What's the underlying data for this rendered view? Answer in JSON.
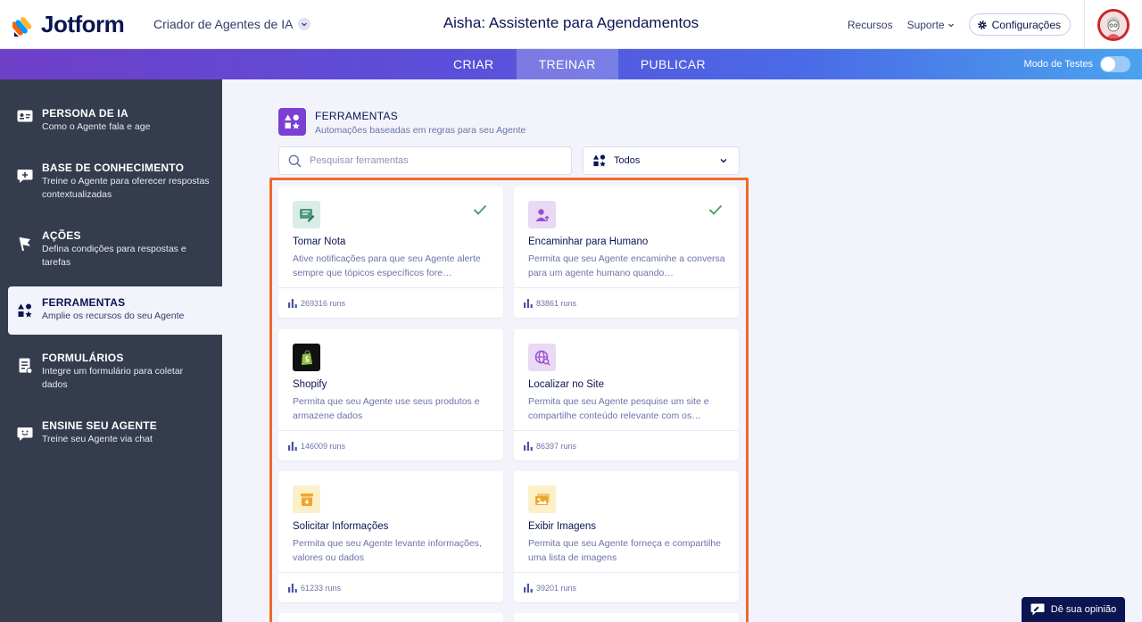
{
  "header": {
    "brand": "Jotform",
    "product": "Criador de Agentes de IA",
    "agent_title": "Aisha: Assistente para Agendamentos",
    "links": {
      "resources": "Recursos",
      "support": "Suporte",
      "settings": "Configurações"
    }
  },
  "nav": {
    "tabs": [
      {
        "label": "CRIAR",
        "active": false
      },
      {
        "label": "TREINAR",
        "active": true
      },
      {
        "label": "PUBLICAR",
        "active": false
      }
    ],
    "test_mode_label": "Modo de Testes",
    "test_mode_on": false
  },
  "sidebar": {
    "items": [
      {
        "title": "PERSONA DE IA",
        "desc": "Como o Agente fala e age",
        "icon": "id-card-icon"
      },
      {
        "title": "BASE DE CONHECIMENTO",
        "desc": "Treine o Agente para oferecer respostas contextualizadas",
        "icon": "chat-plus-icon"
      },
      {
        "title": "AÇÕES",
        "desc": "Defina condições para respostas e tarefas",
        "icon": "flag-icon"
      },
      {
        "title": "FERRAMENTAS",
        "desc": "Amplie os recursos do seu Agente",
        "icon": "shapes-icon",
        "active": true
      },
      {
        "title": "FORMULÁRIOS",
        "desc": "Integre um formulário para coletar dados",
        "icon": "form-icon"
      },
      {
        "title": "ENSINE SEU AGENTE",
        "desc": "Treine seu Agente via chat",
        "icon": "smile-chat-icon"
      }
    ]
  },
  "tools": {
    "title": "FERRAMENTAS",
    "subtitle": "Automações baseadas em regras para seu Agente",
    "search_placeholder": "Pesquisar ferramentas",
    "filter_value": "Todos",
    "cards": [
      {
        "title": "Tomar Nota",
        "desc": "Ative notificações para que seu Agente alerte sempre que tópicos específicos fore…",
        "runs": "269316 runs",
        "enabled": true,
        "icon": "note-icon",
        "icon_bg": "#d9ede5",
        "icon_fg": "#4f9a83"
      },
      {
        "title": "Encaminhar para Humano",
        "desc": "Permita que seu Agente encaminhe a conversa para um agente humano quando…",
        "runs": "83861 runs",
        "enabled": true,
        "icon": "user-arrow-icon",
        "icon_bg": "#ead9f5",
        "icon_fg": "#9a4fd1"
      },
      {
        "title": "Shopify",
        "desc": "Permita que seu Agente use seus produtos e armazene dados",
        "runs": "146009 runs",
        "enabled": false,
        "icon": "shopify-icon",
        "icon_bg": "#111111",
        "icon_fg": "#95bf47"
      },
      {
        "title": "Localizar no Site",
        "desc": "Permita que seu Agente pesquise um site e compartilhe conteúdo relevante com os…",
        "runs": "86397 runs",
        "enabled": false,
        "icon": "globe-search-icon",
        "icon_bg": "#ead9f5",
        "icon_fg": "#9a4fd1"
      },
      {
        "title": "Solicitar Informações",
        "desc": "Permita que seu Agente levante informações, valores ou dados",
        "runs": "61233 runs",
        "enabled": false,
        "icon": "inbox-icon",
        "icon_bg": "#fdf0c8",
        "icon_fg": "#f0a52a"
      },
      {
        "title": "Exibir Imagens",
        "desc": "Permita que seu Agente forneça e compartilhe uma lista de imagens",
        "runs": "39201 runs",
        "enabled": false,
        "icon": "images-icon",
        "icon_bg": "#fdf0c8",
        "icon_fg": "#f0a52a"
      }
    ]
  },
  "feedback_label": "Dê sua opinião",
  "colors": {
    "accent_purple": "#7b3fd4",
    "highlight_border": "#ec6a2d",
    "sidebar_bg": "#343c4e",
    "check_green": "#4fa06b"
  }
}
